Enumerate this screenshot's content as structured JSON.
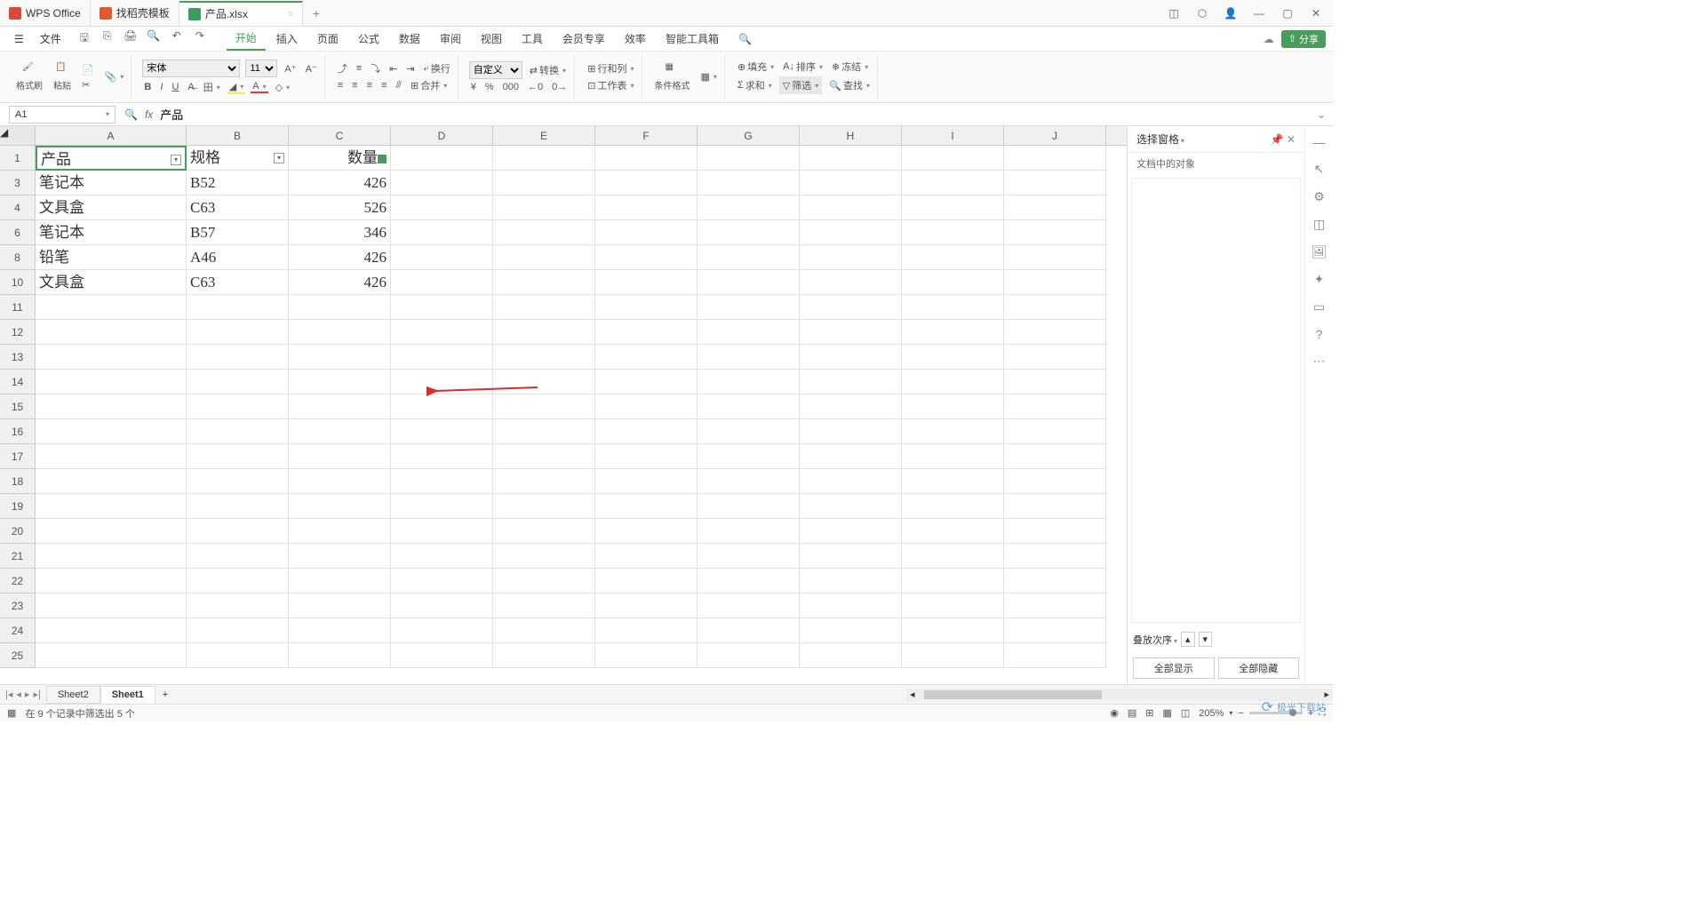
{
  "tabs": [
    {
      "label": "WPS Office",
      "icon": "wps"
    },
    {
      "label": "找稻壳模板",
      "icon": "dao"
    },
    {
      "label": "产品.xlsx",
      "icon": "xls",
      "active": true
    }
  ],
  "menubar": {
    "file": "文件",
    "items": [
      "开始",
      "插入",
      "页面",
      "公式",
      "数据",
      "审阅",
      "视图",
      "工具",
      "会员专享",
      "效率",
      "智能工具箱"
    ],
    "active": "开始",
    "share": "分享"
  },
  "ribbon": {
    "brush": "格式刷",
    "paste": "粘贴",
    "font": "宋体",
    "size": "11",
    "wrap": "换行",
    "custom": "自定义",
    "convert": "转换",
    "rowcol": "行和列",
    "worksheet": "工作表",
    "condfmt": "条件格式",
    "fill": "填充",
    "sort": "排序",
    "freeze": "冻结",
    "sum": "求和",
    "filter": "筛选",
    "find": "查找",
    "mergectr": "合并"
  },
  "namebox": "A1",
  "formula": "产品",
  "columns": [
    "A",
    "B",
    "C",
    "D",
    "E",
    "F",
    "G",
    "H",
    "I",
    "J"
  ],
  "visibleRows": [
    1,
    3,
    4,
    6,
    8,
    10,
    11,
    12,
    13,
    14,
    15,
    16,
    17,
    18,
    19,
    20,
    21,
    22,
    23,
    24,
    25
  ],
  "gridData": {
    "1": {
      "A": "产品",
      "B": "规格",
      "C": "数量",
      "filterA": true,
      "filterB": true,
      "indC": true
    },
    "3": {
      "A": "笔记本",
      "B": "B52",
      "C": "426"
    },
    "4": {
      "A": "文具盒",
      "B": "C63",
      "C": "526"
    },
    "6": {
      "A": "笔记本",
      "B": "B57",
      "C": "346"
    },
    "8": {
      "A": "铅笔",
      "B": "A46",
      "C": "426"
    },
    "10": {
      "A": "文具盒",
      "B": "C63",
      "C": "426"
    }
  },
  "rightPane": {
    "title": "选择窗格",
    "sub": "文档中的对象",
    "order": "叠放次序",
    "showAll": "全部显示",
    "hideAll": "全部隐藏"
  },
  "sheets": {
    "list": [
      "Sheet2",
      "Sheet1"
    ],
    "active": "Sheet1"
  },
  "status": {
    "left": "在 9 个记录中筛选出 5 个",
    "zoom": "205%"
  },
  "watermark": "极光下载站"
}
